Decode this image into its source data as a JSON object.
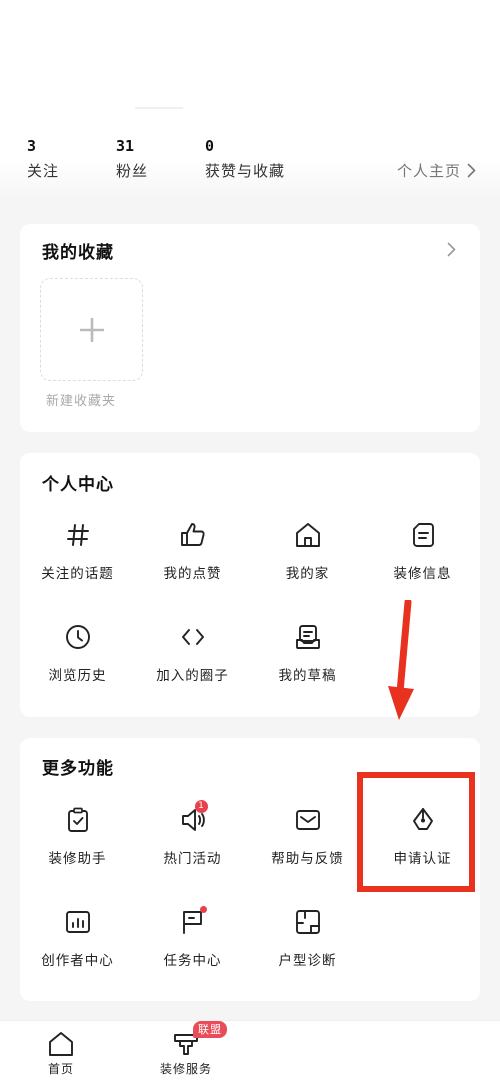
{
  "stats": {
    "following": {
      "count": "3",
      "label": "关注"
    },
    "followers": {
      "count": "31",
      "label": "粉丝"
    },
    "likes": {
      "count": "0",
      "label": "获赞与收藏"
    },
    "profile_link": "个人主页"
  },
  "favorites": {
    "title": "我的收藏",
    "new_folder_label": "新建收藏夹"
  },
  "personal_center": {
    "title": "个人中心",
    "items": [
      {
        "label": "关注的话题",
        "icon": "hash-icon"
      },
      {
        "label": "我的点赞",
        "icon": "thumbs-up-icon"
      },
      {
        "label": "我的家",
        "icon": "home-icon"
      },
      {
        "label": "装修信息",
        "icon": "document-icon"
      },
      {
        "label": "浏览历史",
        "icon": "clock-icon"
      },
      {
        "label": "加入的圈子",
        "icon": "code-brackets-icon"
      },
      {
        "label": "我的草稿",
        "icon": "draft-icon"
      }
    ]
  },
  "more_features": {
    "title": "更多功能",
    "items": [
      {
        "label": "装修助手",
        "icon": "clipboard-check-icon"
      },
      {
        "label": "热门活动",
        "icon": "megaphone-icon",
        "badge": "1"
      },
      {
        "label": "帮助与反馈",
        "icon": "mail-icon"
      },
      {
        "label": "申请认证",
        "icon": "pen-nib-icon"
      },
      {
        "label": "创作者中心",
        "icon": "bar-chart-icon"
      },
      {
        "label": "任务中心",
        "icon": "flag-icon"
      },
      {
        "label": "户型诊断",
        "icon": "floor-plan-icon"
      }
    ]
  },
  "bottom_nav": {
    "home": "首页",
    "service": "装修服务",
    "service_badge": "联盟"
  },
  "colors": {
    "annotation_red": "#e8321f",
    "badge_red": "#e8414a",
    "background": "#f5f5f6"
  }
}
